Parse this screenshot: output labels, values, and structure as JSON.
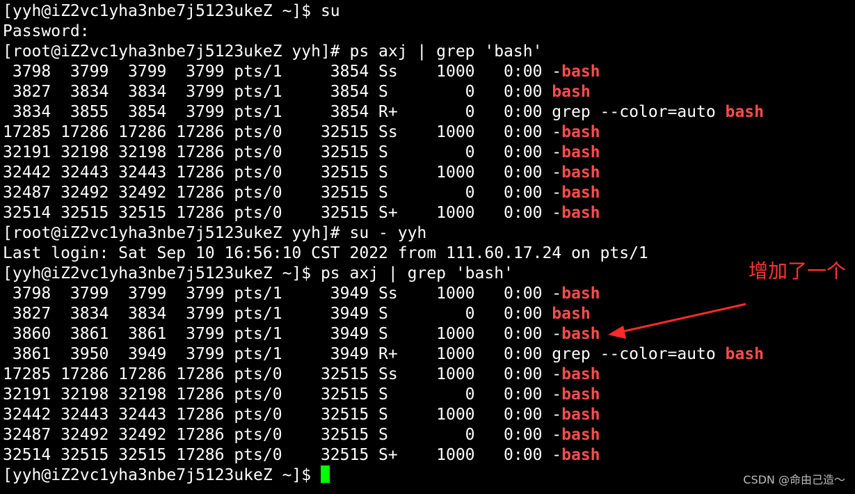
{
  "terminal": {
    "lines": [
      {
        "text": "[yyh@iZ2vc1yha3nbe7j5123ukeZ ~]$ su"
      },
      {
        "text": "Password:"
      },
      {
        "text": "[root@iZ2vc1yha3nbe7j5123ukeZ yyh]# ps axj | grep 'bash'"
      },
      {
        "text": " 3798  3799  3799  3799 pts/1     3854 Ss    1000   0:00 -",
        "hl": "bash"
      },
      {
        "text": " 3827  3834  3834  3799 pts/1     3854 S        0   0:00 ",
        "hl": "bash"
      },
      {
        "text": " 3834  3855  3854  3799 pts/1     3854 R+       0   0:00 grep --color=auto ",
        "hl": "bash"
      },
      {
        "text": "17285 17286 17286 17286 pts/0    32515 Ss    1000   0:00 -",
        "hl": "bash"
      },
      {
        "text": "32191 32198 32198 17286 pts/0    32515 S        0   0:00 -",
        "hl": "bash"
      },
      {
        "text": "32442 32443 32443 17286 pts/0    32515 S     1000   0:00 -",
        "hl": "bash"
      },
      {
        "text": "32487 32492 32492 17286 pts/0    32515 S        0   0:00 -",
        "hl": "bash"
      },
      {
        "text": "32514 32515 32515 17286 pts/0    32515 S+    1000   0:00 -",
        "hl": "bash"
      },
      {
        "text": "[root@iZ2vc1yha3nbe7j5123ukeZ yyh]# su - yyh"
      },
      {
        "text": "Last login: Sat Sep 10 16:56:10 CST 2022 from 111.60.17.24 on pts/1"
      },
      {
        "text": "[yyh@iZ2vc1yha3nbe7j5123ukeZ ~]$ ps axj | grep 'bash'"
      },
      {
        "text": " 3798  3799  3799  3799 pts/1     3949 Ss    1000   0:00 -",
        "hl": "bash"
      },
      {
        "text": " 3827  3834  3834  3799 pts/1     3949 S        0   0:00 ",
        "hl": "bash"
      },
      {
        "text": " 3860  3861  3861  3799 pts/1     3949 S     1000   0:00 -",
        "hl": "bash"
      },
      {
        "text": " 3861  3950  3949  3799 pts/1     3949 R+    1000   0:00 grep --color=auto ",
        "hl": "bash"
      },
      {
        "text": "17285 17286 17286 17286 pts/0    32515 Ss    1000   0:00 -",
        "hl": "bash"
      },
      {
        "text": "32191 32198 32198 17286 pts/0    32515 S        0   0:00 -",
        "hl": "bash"
      },
      {
        "text": "32442 32443 32443 17286 pts/0    32515 S     1000   0:00 -",
        "hl": "bash"
      },
      {
        "text": "32487 32492 32492 17286 pts/0    32515 S        0   0:00 -",
        "hl": "bash"
      },
      {
        "text": "32514 32515 32515 17286 pts/0    32515 S+    1000   0:00 -",
        "hl": "bash"
      }
    ],
    "prompt": "[yyh@iZ2vc1yha3nbe7j5123ukeZ ~]$ "
  },
  "annotation": {
    "text": "增加了一个"
  },
  "watermark": "CSDN @命由己造～",
  "colors": {
    "background": "#000000",
    "foreground": "#ffffff",
    "highlight": "#ff4d4d",
    "cursor": "#00ff00",
    "annotation": "#ff3333"
  }
}
